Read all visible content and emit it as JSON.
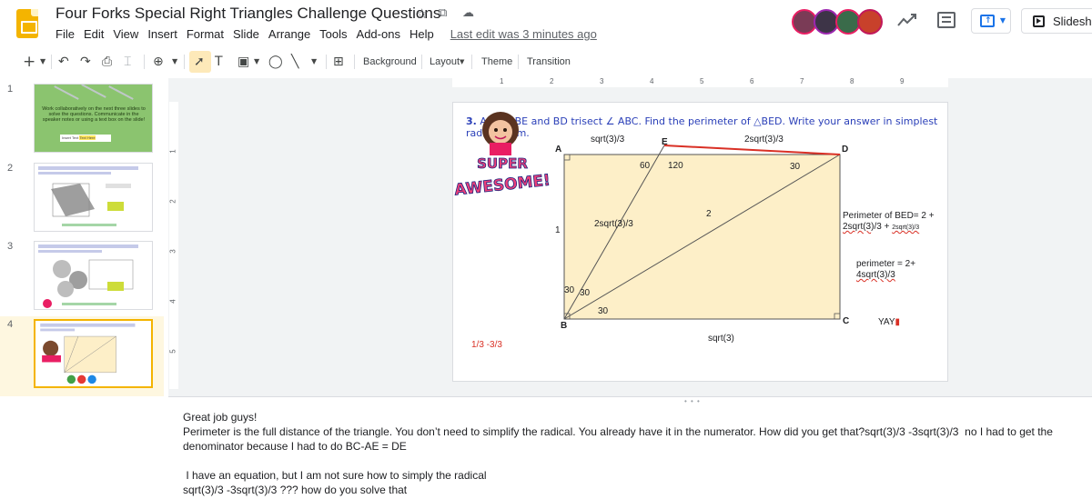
{
  "app": {
    "title": "Four Forks Special Right Triangles Challenge Questions",
    "menu": [
      "File",
      "Edit",
      "View",
      "Insert",
      "Format",
      "Slide",
      "Arrange",
      "Tools",
      "Add-ons",
      "Help"
    ],
    "last_edit": "Last edit was 3 minutes ago",
    "slideshow_label": "Slidesho",
    "colors": {
      "logo": "#f4b400",
      "accent": "#1a73e8",
      "selected_bg": "#fef7e0",
      "question_blue": "#2a3fb8",
      "slide_fill": "#fdefc8"
    }
  },
  "toolbar": {
    "background_label": "Background",
    "layout_label": "Layout",
    "theme_label": "Theme",
    "transition_label": "Transition"
  },
  "filmstrip": {
    "slide_numbers": [
      "1",
      "2",
      "3",
      "4"
    ],
    "slide1_text": "Work collaboratively on the next three slides to solve the questions. Communicate in the speaker notes or using a text box on the slide!",
    "slide1_box_prefix": "Insert Text",
    "slide1_box_highlight": "Text Here",
    "selected_slide": "4"
  },
  "rulers": {
    "h": [
      "1",
      "2",
      "3",
      "4",
      "5",
      "6",
      "7",
      "8",
      "9"
    ],
    "v": [
      "1",
      "2",
      "3",
      "4",
      "5"
    ]
  },
  "slide": {
    "question_num": "3.",
    "question": "AB=1, BE and BD trisect ∠ ABC. Find the perimeter of △BED. Write your answer in simplest radical form.",
    "labels": {
      "A": "A",
      "E": "E",
      "D": "D",
      "B": "B",
      "C": "C",
      "top_left": "sqrt(3)/3",
      "top_right": "2sqrt(3)/3",
      "angle_60": "60",
      "angle_120": "120",
      "angle_30_d": "30",
      "side_2": "2",
      "be_len": "2sqrt(3)/3",
      "ab_len": "1",
      "b_30a": "30",
      "b_30b": "30",
      "b_30c": "30",
      "bottom": "sqrt(3)",
      "red_note": "1/3 -3/3",
      "perimeter1_a": "Perimeter of BED= 2 +",
      "perimeter1_b": "2sqrt(3",
      "perimeter1_c": ")/3 +",
      "perimeter1_small": "2sqrt(3)/3",
      "perimeter2_a": "perimeter = 2+",
      "perimeter2_b": "4sqrt(3)/3",
      "yay": "YAY"
    },
    "sticker": {
      "line1": "SUPER",
      "line2": "AWESOME!"
    }
  },
  "notes": {
    "text": "Great job guys!\nPerimeter is the full distance of the triangle. You don’t need to simplify the radical. You already have it in the numerator. How did you get that?sqrt(3)/3 -3sqrt(3)/3  no I had to get the denominator because I had to do BC-AE = DE\n\n I have an equation, but I am not sure how to simply the radical\nsqrt(3)/3 -3sqrt(3)/3 ??? how do you solve that"
  }
}
